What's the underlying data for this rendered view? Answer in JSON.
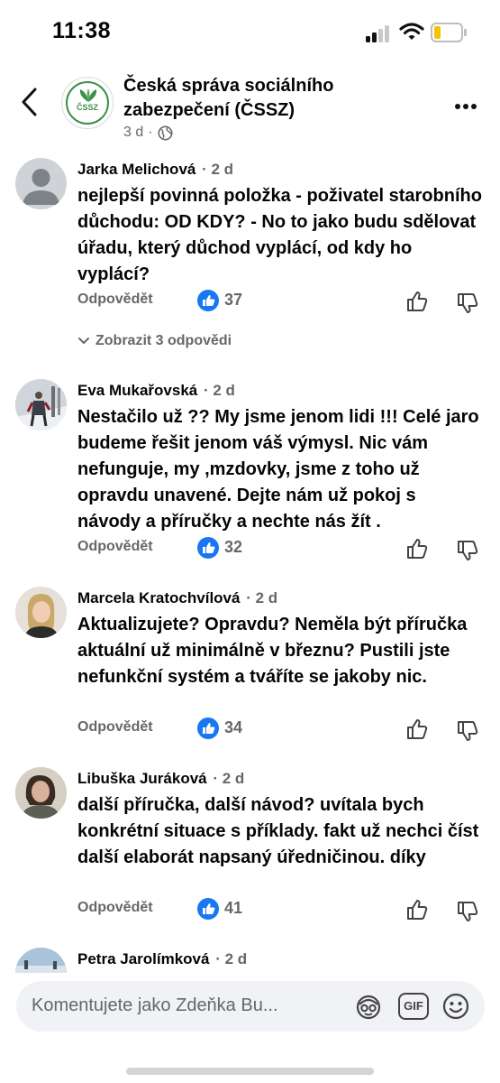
{
  "status_bar": {
    "time": "11:38",
    "battery_percent": 25
  },
  "header": {
    "title": "Česká správa sociálního zabezpečení (ČSSZ)",
    "age": "3 d",
    "separator": "·",
    "logo_text": "ČSSZ"
  },
  "colors": {
    "like_blue": "#1877f2",
    "meta_gray": "#65676b",
    "logo_green": "#3e8f4a",
    "battery_yellow": "#f2c500"
  },
  "comments": [
    {
      "author": "Jarka Melichová",
      "age": "· 2 d",
      "text": "nejlepší povinná položka - poživatel starobního důchodu: OD KDY? - No to jako budu sdělovat úřadu, který důchod vyplácí, od kdy ho vyplácí?",
      "reply_label": "Odpovědět",
      "likes": "37",
      "avatar": "default-avatar-icon",
      "view_replies": "Zobrazit 3 odpovědi"
    },
    {
      "author": "Eva Mukařovská",
      "age": "· 2 d",
      "text": "Nestačilo už ?? My jsme jenom lidi !!! Celé jaro budeme řešit jenom váš výmysl. Nic vám nefunguje, my ,mzdovky, jsme z toho už opravdu unavené. Dejte nám už pokoj s návody a příručky a nechte nás žít  .",
      "reply_label": "Odpovědět",
      "likes": "32",
      "avatar": "photo"
    },
    {
      "author": "Marcela Kratochvílová",
      "age": "· 2 d",
      "text": "Aktualizujete? Opravdu? Neměla být příručka aktuální už minimálně v březnu? Pustili jste nefunkční systém a tváříte se jakoby nic.",
      "reply_label": "Odpovědět",
      "likes": "34",
      "avatar": "photo"
    },
    {
      "author": "Libuška Juráková",
      "age": "· 2 d",
      "text": "další příručka, další návod? uvítala bych konkrétní situace s příklady. fakt už nechci číst další elaborát napsaný úředničinou. díky",
      "reply_label": "Odpovědět",
      "likes": "41",
      "avatar": "photo"
    },
    {
      "author": "Petra Jarolímková",
      "age": "· 2 d",
      "avatar": "photo"
    }
  ],
  "composer": {
    "placeholder": "Komentujete jako Zdeňka Bu...",
    "gif_label": "GIF",
    "icons": [
      "avatar-sticker-icon",
      "gif-icon",
      "emoji-icon"
    ]
  }
}
